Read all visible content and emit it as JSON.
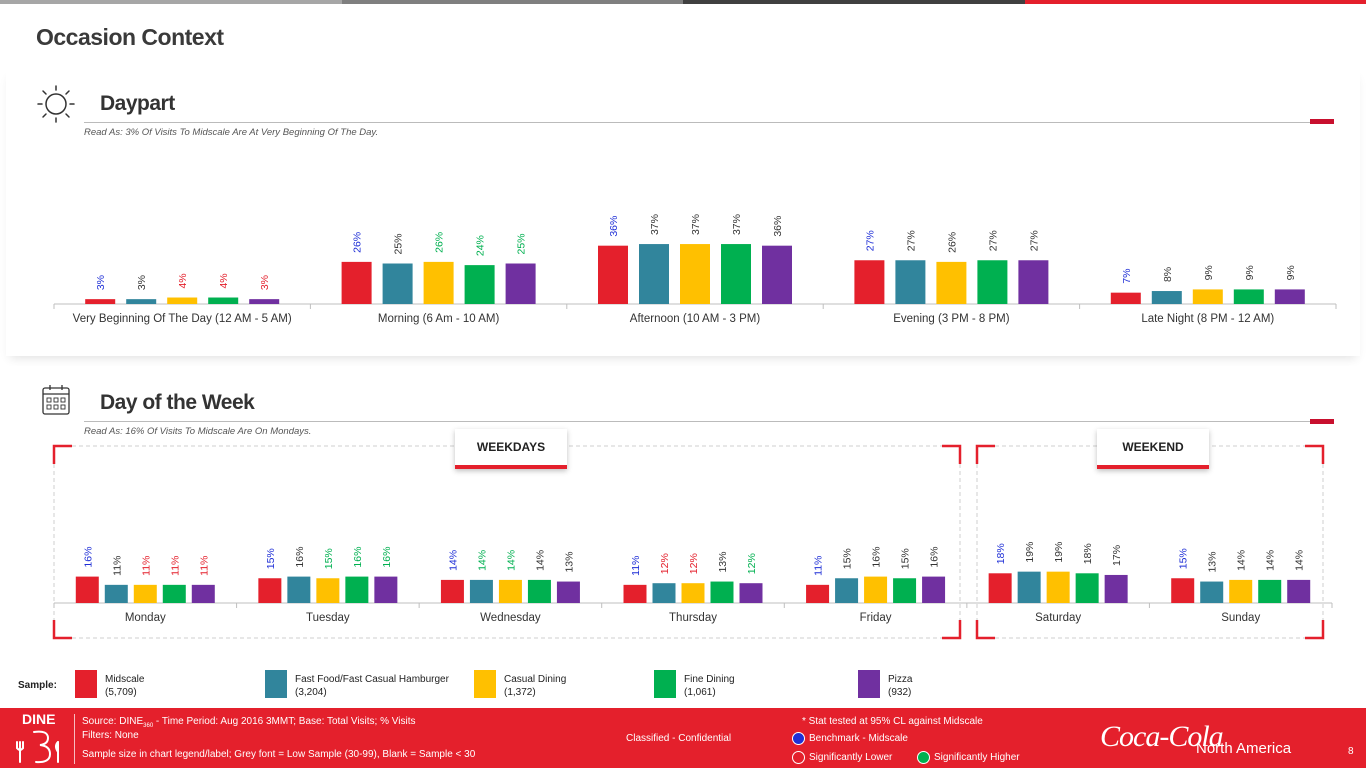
{
  "page": {
    "title": "Occasion Context",
    "topbar_colors": [
      "#a6a6a6",
      "#7f7f7f",
      "#404040",
      "#e4202c"
    ]
  },
  "daypart": {
    "title": "Daypart",
    "read_as": "Read As: 3% Of Visits To Midscale Are At Very Beginning Of The Day."
  },
  "dow": {
    "title": "Day of the Week",
    "read_as": "Read As: 16% Of Visits To Midscale Are On Mondays.",
    "weekdays_label": "WEEKDAYS",
    "weekend_label": "WEEKEND"
  },
  "chart_data": [
    {
      "type": "bar",
      "categories": [
        "Very Beginning Of The Day (12 AM - 5 AM)",
        "Morning (6 Am - 10 AM)",
        "Afternoon (10 AM - 3 PM)",
        "Evening (3 PM - 8 PM)",
        "Late Night (8 PM - 12 AM)"
      ],
      "series": [
        {
          "name": "Midscale",
          "values": [
            3,
            26,
            36,
            27,
            7
          ]
        },
        {
          "name": "Fast Food/Fast Casual Hamburger",
          "values": [
            3,
            25,
            37,
            27,
            8
          ]
        },
        {
          "name": "Casual Dining",
          "values": [
            4,
            26,
            37,
            26,
            9
          ]
        },
        {
          "name": "Fine Dining",
          "values": [
            4,
            24,
            37,
            27,
            9
          ]
        },
        {
          "name": "Pizza",
          "values": [
            3,
            25,
            36,
            27,
            9
          ]
        }
      ],
      "data_labels": [
        [
          "3%",
          "3%",
          "4%",
          "4%",
          "3%"
        ],
        [
          "26%",
          "25%",
          "26%",
          "24%",
          "25%"
        ],
        [
          "36%",
          "37%",
          "37%",
          "37%",
          "36%"
        ],
        [
          "27%",
          "27%",
          "26%",
          "27%",
          "27%"
        ],
        [
          "7%",
          "8%",
          "9%",
          "9%",
          "9%"
        ]
      ],
      "label_colors": [
        [
          "#1f2fd6",
          "#333333",
          "#e4202c",
          "#e4202c",
          "#e4202c"
        ],
        [
          "#1f2fd6",
          "#333333",
          "#00b050",
          "#00b050",
          "#00b050"
        ],
        [
          "#1f2fd6",
          "#333333",
          "#333333",
          "#333333",
          "#333333"
        ],
        [
          "#1f2fd6",
          "#333333",
          "#333333",
          "#333333",
          "#333333"
        ],
        [
          "#1f2fd6",
          "#333333",
          "#333333",
          "#333333",
          "#333333"
        ]
      ],
      "ylim": [
        0,
        100
      ]
    },
    {
      "type": "bar",
      "categories": [
        "Monday",
        "Tuesday",
        "Wednesday",
        "Thursday",
        "Friday",
        "Saturday",
        "Sunday"
      ],
      "series": [
        {
          "name": "Midscale",
          "values": [
            16,
            15,
            14,
            11,
            11,
            18,
            15
          ]
        },
        {
          "name": "Fast Food/Fast Casual Hamburger",
          "values": [
            11,
            16,
            14,
            12,
            15,
            19,
            13
          ]
        },
        {
          "name": "Casual Dining",
          "values": [
            11,
            15,
            14,
            12,
            16,
            19,
            14
          ]
        },
        {
          "name": "Fine Dining",
          "values": [
            11,
            16,
            14,
            13,
            15,
            18,
            14
          ]
        },
        {
          "name": "Pizza",
          "values": [
            11,
            16,
            13,
            12,
            16,
            17,
            14
          ]
        }
      ],
      "data_labels": [
        [
          "16%",
          "11%",
          "11%",
          "11%",
          "11%"
        ],
        [
          "15%",
          "16%",
          "15%",
          "16%",
          "16%"
        ],
        [
          "14%",
          "14%",
          "14%",
          "14%",
          "13%"
        ],
        [
          "11%",
          "12%",
          "12%",
          "13%",
          "12%"
        ],
        [
          "11%",
          "15%",
          "16%",
          "15%",
          "16%"
        ],
        [
          "18%",
          "19%",
          "19%",
          "18%",
          "17%"
        ],
        [
          "15%",
          "13%",
          "14%",
          "14%",
          "14%"
        ]
      ],
      "label_colors": [
        [
          "#1f2fd6",
          "#333333",
          "#e4202c",
          "#e4202c",
          "#e4202c"
        ],
        [
          "#1f2fd6",
          "#333333",
          "#00b050",
          "#00b050",
          "#00b050"
        ],
        [
          "#1f2fd6",
          "#00b050",
          "#00b050",
          "#333333",
          "#333333"
        ],
        [
          "#1f2fd6",
          "#e4202c",
          "#e4202c",
          "#333333",
          "#00b050"
        ],
        [
          "#1f2fd6",
          "#333333",
          "#333333",
          "#333333",
          "#333333"
        ],
        [
          "#1f2fd6",
          "#333333",
          "#333333",
          "#333333",
          "#333333"
        ],
        [
          "#1f2fd6",
          "#333333",
          "#333333",
          "#333333",
          "#333333"
        ]
      ],
      "ylim": [
        0,
        100
      ]
    }
  ],
  "legend": {
    "sample_label": "Sample:",
    "items": [
      {
        "name": "Midscale",
        "n": "(5,709)",
        "color": "#e4202c"
      },
      {
        "name": "Fast Food/Fast Casual Hamburger",
        "n": "(3,204)",
        "color": "#31859c"
      },
      {
        "name": "Casual Dining",
        "n": "(1,372)",
        "color": "#ffc000"
      },
      {
        "name": "Fine Dining",
        "n": "(1,061)",
        "color": "#00b050"
      },
      {
        "name": "Pizza",
        "n": "(932)",
        "color": "#7030a0"
      }
    ]
  },
  "footer": {
    "logo": "DINE",
    "source_prefix": "Source: DINE",
    "source_sub": "360",
    "source_rest": " - Time Period: Aug 2016 3MMT; Base: Total Visits; % Visits",
    "filters": "Filters: None",
    "sample_note": "Sample size in chart legend/label;  Grey font = Low Sample (30-99), Blank = Sample < 30",
    "classified": "Classified - Confidential",
    "stat_note": "* Stat tested at 95% CL against Midscale",
    "benchmark": "Benchmark - Midscale",
    "sig_lower": "Significantly Lower",
    "sig_higher": "Significantly Higher",
    "brand": "Coca-Cola",
    "region": "North America",
    "page_number": "8"
  }
}
